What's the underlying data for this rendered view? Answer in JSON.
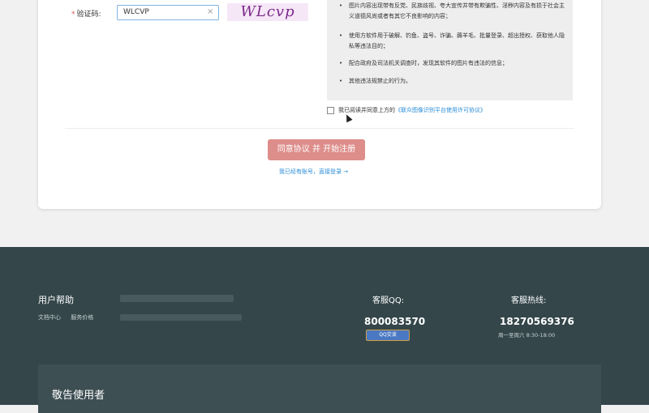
{
  "form": {
    "captcha_label": "验证码:",
    "required_mark": "*",
    "captcha_value": "WLCVP",
    "captcha_clear": "×",
    "captcha_image_text": "WLcvp"
  },
  "terms": {
    "items": [
      "图片内容出现带有反党、民族歧视、夸大宣传并带有欺骗性、淫秽内容及有损于社会主义道德风尚或者有其它不良影响的内容；",
      "使用方软件用于破解、钓鱼、盗号、诈骗、薅羊毛、批量登录、超出授权、获取他人隐私等违法目的；",
      "配合政府及司法机关调查时，发现其软件的图片有违法的信息；",
      "其他违法规禁止的行为。"
    ],
    "bullet": "•"
  },
  "agree": {
    "prefix": "我已阅读并同意上方的",
    "link": "《联众图像识别平台使用许可协议》"
  },
  "submit_label": "同意协议 并 开始注册",
  "login_link": "我已经有账号，直接登录 →",
  "footer": {
    "help_title": "用户帮助",
    "help_links": [
      "文档中心",
      "服务价格"
    ],
    "qq_label": "客服QQ:",
    "qq_number": "800083570",
    "qq_badge": "QQ交谈",
    "hotline_label": "客服热线:",
    "hotline_number": "18270569376",
    "hotline_hours": "周一至周六 8:30-18:00",
    "notice_title": "敬告使用者"
  }
}
